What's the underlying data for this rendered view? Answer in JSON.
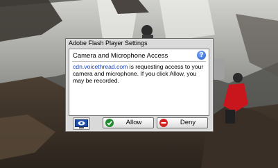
{
  "dialog": {
    "title": "Adobe Flash Player Settings",
    "heading": "Camera and Microphone Access",
    "help_symbol": "?",
    "domain": "cdn.voicethread.com",
    "message": " is requesting access to your camera and microphone. If you click  Allow, you may be recorded.",
    "allow_label": "Allow",
    "deny_label": "Deny",
    "icons": {
      "help": "help-icon",
      "monitor": "monitor-icon",
      "allow": "checkmark-icon",
      "deny": "deny-icon"
    },
    "colors": {
      "link": "#1a44b8",
      "allow_icon": "#1f8b2e",
      "deny_icon": "#d42020",
      "help_icon": "#2457c9"
    }
  }
}
